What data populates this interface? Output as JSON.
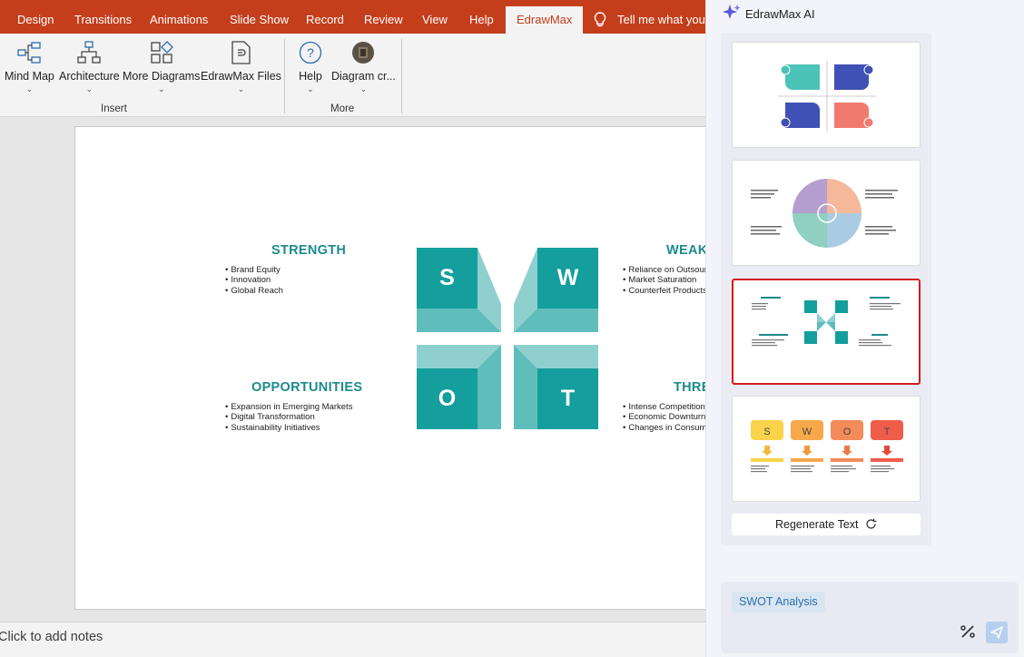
{
  "ribbon": {
    "tabs": [
      "Design",
      "Transitions",
      "Animations",
      "Slide Show",
      "Record",
      "Review",
      "View",
      "Help"
    ],
    "active_tab": "EdrawMax",
    "tell_me": "Tell me what you w",
    "buttons": {
      "mind_map": "Mind Map",
      "architecture": "Architecture",
      "more_diagrams": "More Diagrams",
      "edrawmax_files": "EdrawMax Files",
      "help": "Help",
      "diagram_cr": "Diagram cr..."
    },
    "groups": {
      "insert": "Insert",
      "more": "More"
    }
  },
  "slide": {
    "strength": {
      "title": "STRENGTH",
      "items": [
        "Brand Equity",
        "Innovation",
        "Global Reach"
      ]
    },
    "weakness": {
      "title": "WEAK",
      "items": [
        "Reliance on Outsourc",
        "Market Saturation",
        "Counterfeit Products"
      ]
    },
    "opportunities": {
      "title": "OPPORTUNITIES",
      "items": [
        "Expansion in Emerging Markets",
        "Digital Transformation",
        "Sustainability Initiatives"
      ]
    },
    "threats": {
      "title": "THRE",
      "items": [
        "Intense Competition",
        "Economic Downturns",
        "Changes in Consume"
      ]
    },
    "letters": {
      "s": "S",
      "w": "W",
      "o": "O",
      "t": "T"
    },
    "accent_color": "#149e9c",
    "light_teal": "#8fd0cf"
  },
  "notes": {
    "placeholder": "Click to add notes"
  },
  "ai_panel": {
    "title": "EdrawMax AI",
    "regenerate": "Regenerate Text",
    "selected_index": 3,
    "chip": "SWOT Analysis",
    "selection_color": "#d11b1b"
  }
}
